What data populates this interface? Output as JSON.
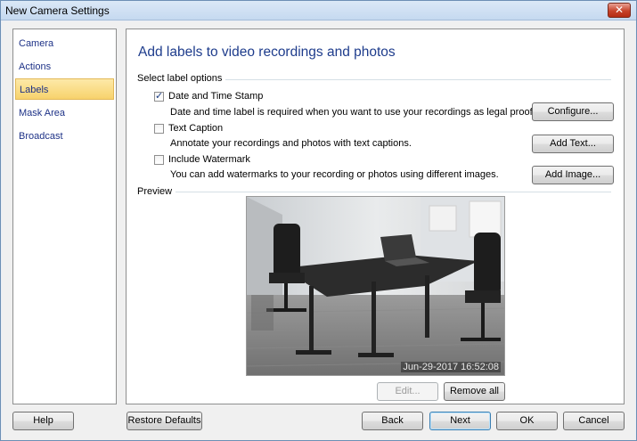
{
  "window": {
    "title": "New Camera Settings",
    "close_label": "✕"
  },
  "sidebar": {
    "items": [
      {
        "label": "Camera"
      },
      {
        "label": "Actions"
      },
      {
        "label": "Labels",
        "selected": true
      },
      {
        "label": "Mask Area"
      },
      {
        "label": "Broadcast"
      }
    ]
  },
  "main": {
    "heading": "Add labels to video recordings and photos",
    "options_group_label": "Select label options",
    "options": [
      {
        "label": "Date and Time Stamp",
        "checked": true,
        "description": "Date and time label is required when you want to use your recordings as legal proof.",
        "button": "Configure..."
      },
      {
        "label": "Text Caption",
        "checked": false,
        "description": "Annotate your recordings and photos with text captions.",
        "button": "Add Text..."
      },
      {
        "label": "Include Watermark",
        "checked": false,
        "description": "You can add watermarks to your recording or photos using different images.",
        "button": "Add Image..."
      }
    ],
    "preview_label": "Preview",
    "preview_timestamp": "Jun-29-2017 16:52:08",
    "edit_button": "Edit...",
    "remove_all_button": "Remove all"
  },
  "footer": {
    "help": "Help",
    "restore_defaults": "Restore Defaults",
    "back": "Back",
    "next": "Next",
    "ok": "OK",
    "cancel": "Cancel"
  },
  "colors": {
    "heading": "#1e3c8c",
    "nav_text": "#1e3287",
    "selected_nav": "#f7d26c"
  }
}
